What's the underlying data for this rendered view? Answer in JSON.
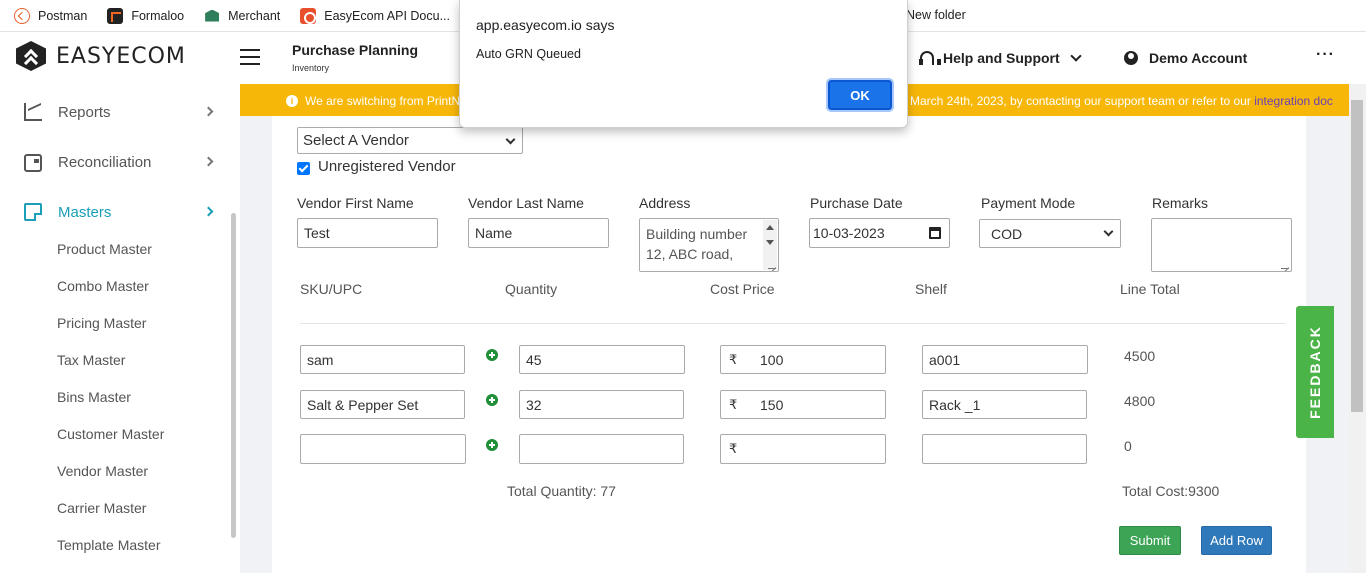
{
  "bookmarks": [
    {
      "label": "Postman",
      "icon": "postman-icon"
    },
    {
      "label": "Formaloo",
      "icon": "formaloo-icon"
    },
    {
      "label": "Merchant",
      "icon": "merchant-icon"
    },
    {
      "label": "EasyEcom API Docu...",
      "icon": "easyecom-api-icon"
    },
    {
      "label": "",
      "icon": "jira-icon"
    }
  ],
  "bookmark_folder": "New folder",
  "brand": "EASYECOM",
  "header": {
    "title": "Purchase Planning",
    "subtitle": "Inventory",
    "help_label": "Help and Support",
    "account_label": "Demo Account",
    "more_label": "···"
  },
  "banner": {
    "left_text": "We are switching from PrintN",
    "right_text": "March 24th, 2023, by contacting our support team or refer to our ",
    "link_text": "integration doc",
    "color": "#f7b709"
  },
  "sidebar": {
    "items": [
      {
        "label": "Reports",
        "icon": "reports-icon"
      },
      {
        "label": "Reconciliation",
        "icon": "reconciliation-icon"
      },
      {
        "label": "Masters",
        "icon": "masters-icon"
      }
    ],
    "subitems": [
      "Product Master",
      "Combo Master",
      "Pricing Master",
      "Tax Master",
      "Bins Master",
      "Customer Master",
      "Vendor Master",
      "Carrier Master",
      "Template Master"
    ],
    "active_color": "#1a9fb8"
  },
  "form": {
    "vendor_select": "Select A Vendor",
    "unregistered_label": "Unregistered Vendor",
    "unregistered_checked": true,
    "fields": {
      "first_name_label": "Vendor First Name",
      "first_name_value": "Test",
      "last_name_label": "Vendor Last Name",
      "last_name_placeholder": "Name",
      "address_label": "Address",
      "address_value": "Building number 12, ABC road,",
      "purchase_date_label": "Purchase Date",
      "purchase_date_value": "10-03-2023",
      "payment_mode_label": "Payment Mode",
      "payment_mode_value": "COD",
      "remarks_label": "Remarks"
    },
    "columns": [
      "SKU/UPC",
      "Quantity",
      "Cost Price",
      "Shelf",
      "Line Total"
    ],
    "currency_symbol": "₹",
    "rows": [
      {
        "sku": "sam",
        "quantity": "45",
        "cost": "100",
        "shelf": "a001",
        "line_total": "4500"
      },
      {
        "sku": "Salt & Pepper Set",
        "quantity": "32",
        "cost": "150",
        "shelf": "Rack _1",
        "line_total": "4800"
      },
      {
        "sku": "",
        "quantity": "",
        "cost": "",
        "shelf": "",
        "line_total": "0"
      }
    ],
    "total_quantity": "Total Quantity: 77",
    "total_cost": "Total Cost:9300",
    "submit_label": "Submit",
    "add_row_label": "Add Row"
  },
  "feedback_label": "FEEDBACK",
  "dialog": {
    "title": "app.easyecom.io says",
    "message": "Auto GRN Queued",
    "ok_label": "OK"
  }
}
